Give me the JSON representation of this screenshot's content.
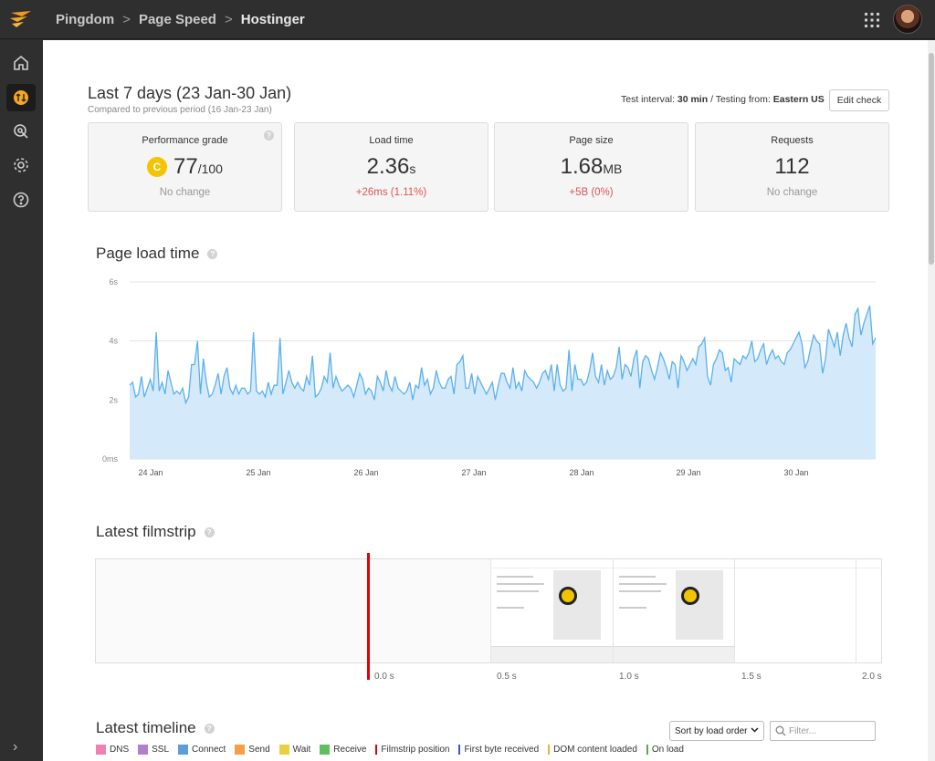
{
  "header": {
    "breadcrumbs": [
      "Pingdom",
      "Page Speed",
      "Hostinger"
    ],
    "separator": ">"
  },
  "sidebar": {
    "items": [
      {
        "name": "home",
        "icon": "home-icon"
      },
      {
        "name": "page-speed",
        "icon": "page-speed-icon",
        "active": true
      },
      {
        "name": "monitor",
        "icon": "monitor-cursor-icon"
      },
      {
        "name": "settings",
        "icon": "gear-icon"
      },
      {
        "name": "help",
        "icon": "help-icon"
      }
    ],
    "expand_label": "›"
  },
  "summary": {
    "title": "Last 7 days (23 Jan-30 Jan)",
    "subtitle": "Compared to previous period (16 Jan-23 Jan)",
    "test_interval_label": "Test interval:",
    "test_interval_value": "30 min",
    "testing_from_label": "/ Testing from:",
    "testing_from_value": "Eastern US",
    "edit_button": "Edit check"
  },
  "cards": [
    {
      "label": "Performance grade",
      "grade_letter": "C",
      "value": "77",
      "unit": "/100",
      "delta": "No change",
      "delta_type": "neutral"
    },
    {
      "label": "Load time",
      "value": "2.36",
      "unit": "s",
      "delta": "+26ms (1.11%)",
      "delta_type": "bad"
    },
    {
      "label": "Page size",
      "value": "1.68",
      "unit": "MB",
      "delta": "+5B (0%)",
      "delta_type": "bad"
    },
    {
      "label": "Requests",
      "value": "112",
      "unit": "",
      "delta": "No change",
      "delta_type": "neutral"
    }
  ],
  "sections": {
    "page_load_time": "Page load time",
    "latest_filmstrip": "Latest filmstrip",
    "latest_timeline": "Latest timeline",
    "help_glyph": "?"
  },
  "chart_data": {
    "type": "area",
    "y_ticks": [
      "0ms",
      "2s",
      "4s",
      "6s"
    ],
    "ylim": [
      0,
      6
    ],
    "x_ticks": [
      "24 Jan",
      "25 Jan",
      "26 Jan",
      "27 Jan",
      "28 Jan",
      "29 Jan",
      "30 Jan"
    ],
    "color": "#5bb0ee",
    "fill": "#d4eafb",
    "values": [
      2.5,
      2.6,
      2.1,
      2.2,
      2.8,
      2.1,
      2.4,
      2.7,
      2.3,
      4.3,
      2.3,
      2.6,
      2.2,
      3.0,
      2.6,
      2.2,
      2.3,
      2.2,
      2.4,
      1.9,
      2.1,
      3.2,
      3.2,
      4.0,
      2.2,
      3.4,
      2.6,
      2.1,
      2.2,
      2.5,
      2.9,
      2.2,
      2.8,
      3.1,
      2.4,
      2.2,
      2.5,
      2.2,
      2.4,
      2.4,
      2.2,
      2.3,
      4.3,
      2.3,
      2.2,
      2.3,
      2.1,
      2.6,
      2.2,
      2.5,
      2.5,
      4.1,
      2.2,
      2.6,
      3.0,
      2.6,
      2.4,
      2.6,
      2.4,
      2.3,
      2.8,
      2.5,
      3.5,
      2.1,
      2.2,
      2.4,
      2.8,
      2.6,
      3.6,
      2.4,
      2.8,
      2.5,
      2.3,
      2.4,
      2.5,
      2.4,
      2.1,
      2.5,
      2.9,
      2.7,
      2.2,
      2.4,
      2.3,
      2.0,
      2.8,
      2.6,
      2.3,
      3.0,
      2.5,
      2.3,
      2.8,
      2.4,
      2.3,
      2.2,
      2.3,
      2.6,
      2.0,
      2.5,
      2.4,
      3.1,
      2.5,
      2.7,
      2.2,
      2.4,
      3.0,
      2.6,
      2.4,
      2.4,
      2.7,
      2.8,
      2.2,
      3.2,
      3.3,
      3.5,
      2.4,
      2.4,
      2.9,
      2.2,
      2.8,
      2.6,
      2.4,
      2.2,
      2.4,
      2.6,
      2.0,
      2.5,
      2.9,
      2.9,
      2.6,
      2.4,
      3.1,
      2.4,
      2.6,
      2.3,
      3.0,
      2.8,
      2.7,
      2.6,
      2.4,
      2.6,
      2.9,
      3.0,
      2.7,
      3.2,
      2.3,
      3.2,
      2.5,
      2.3,
      2.4,
      3.7,
      2.3,
      3.2,
      2.7,
      2.7,
      2.5,
      2.6,
      3.0,
      3.6,
      2.8,
      2.6,
      3.2,
      2.5,
      3.0,
      2.7,
      2.8,
      3.1,
      3.8,
      2.7,
      3.2,
      3.1,
      2.8,
      3.4,
      3.7,
      2.4,
      3.3,
      3.5,
      3.4,
      3.0,
      2.7,
      3.1,
      3.6,
      3.4,
      3.1,
      2.7,
      3.3,
      3.2,
      2.4,
      3.5,
      3.3,
      3.0,
      3.2,
      3.4,
      3.2,
      3.8,
      3.9,
      4.1,
      2.8,
      2.5,
      3.2,
      3.4,
      3.7,
      3.6,
      3.0,
      3.1,
      2.6,
      3.4,
      3.3,
      3.2,
      3.5,
      3.4,
      3.6,
      4.0,
      3.3,
      3.4,
      3.7,
      3.9,
      3.2,
      3.5,
      3.7,
      3.4,
      3.5,
      3.3,
      3.2,
      3.6,
      3.7,
      3.9,
      4.1,
      4.3,
      3.9,
      3.1,
      3.3,
      3.8,
      4.2,
      4.0,
      3.9,
      2.9,
      3.4,
      4.4,
      4.1,
      3.8,
      4.3,
      3.5,
      4.2,
      4.6,
      4.1,
      3.8,
      4.9,
      5.1,
      4.2,
      4.6,
      4.9,
      5.2,
      3.9,
      4.1
    ]
  },
  "filmstrip": {
    "ticks": [
      "0.0 s",
      "0.5 s",
      "1.0 s",
      "1.5 s",
      "2.0 s"
    ]
  },
  "timeline": {
    "sort_label": "Sort by load order",
    "filter_placeholder": "Filter...",
    "legend": [
      {
        "label": "DNS",
        "color": "#f07fb3",
        "kind": "swatch"
      },
      {
        "label": "SSL",
        "color": "#b27ec9",
        "kind": "swatch"
      },
      {
        "label": "Connect",
        "color": "#5a9fdc",
        "kind": "swatch"
      },
      {
        "label": "Send",
        "color": "#f5a045",
        "kind": "swatch"
      },
      {
        "label": "Wait",
        "color": "#e8d040",
        "kind": "swatch"
      },
      {
        "label": "Receive",
        "color": "#5fbf5f",
        "kind": "swatch"
      },
      {
        "label": "Filmstrip position",
        "color": "#e00000",
        "kind": "bar"
      },
      {
        "label": "First byte received",
        "color": "#3a56c8",
        "kind": "bar"
      },
      {
        "label": "DOM content loaded",
        "color": "#f0b030",
        "kind": "bar"
      },
      {
        "label": "On load",
        "color": "#4cae4c",
        "kind": "bar"
      }
    ]
  }
}
